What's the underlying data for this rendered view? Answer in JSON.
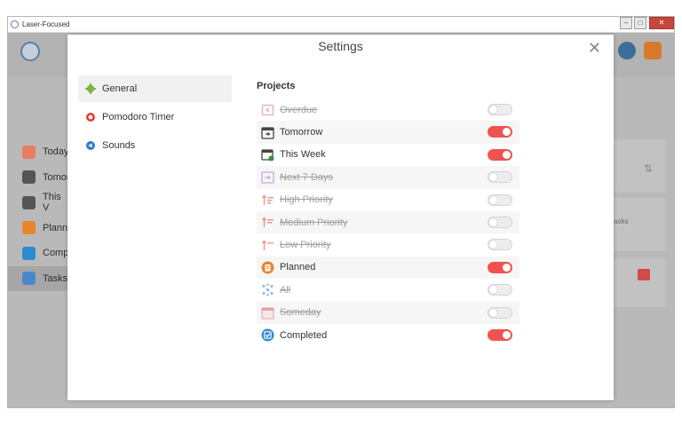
{
  "window": {
    "title": "Laser-Focused"
  },
  "background": {
    "sidebar_items": [
      {
        "label": "Today",
        "color": "#e67e62",
        "selected": false
      },
      {
        "label": "Tomor",
        "color": "#555555",
        "selected": false
      },
      {
        "label": "This V",
        "color": "#555555",
        "selected": false
      },
      {
        "label": "Plann",
        "color": "#e8862e",
        "selected": false
      },
      {
        "label": "Comp",
        "color": "#2f8bd0",
        "selected": false
      },
      {
        "label": "Tasks",
        "color": "#4c88c9",
        "selected": true
      }
    ],
    "right_text": "asks",
    "sort_icon_glyph": "⇅"
  },
  "settings": {
    "title": "Settings",
    "close_glyph": "✕",
    "nav": [
      {
        "label": "General",
        "icon": "gear-icon",
        "color": "#7cb342",
        "active": true
      },
      {
        "label": "Pomodoro Timer",
        "icon": "timer-icon",
        "color": "#e53935",
        "active": false
      },
      {
        "label": "Sounds",
        "icon": "speaker-icon",
        "color": "#2f7fcf",
        "active": false
      }
    ],
    "projects_heading": "Projects",
    "projects": [
      {
        "label": "Overdue",
        "icon": "overdue-icon",
        "color": "#e0575a",
        "enabled": false
      },
      {
        "label": "Tomorrow",
        "icon": "tomorrow-icon",
        "color": "#444444",
        "enabled": true
      },
      {
        "label": "This Week",
        "icon": "this-week-icon",
        "color": "#444444",
        "enabled": true
      },
      {
        "label": "Next 7 Days",
        "icon": "next-7-days-icon",
        "color": "#8e5bd3",
        "enabled": false
      },
      {
        "label": "High Priority",
        "icon": "high-priority-icon",
        "color": "#e53935",
        "enabled": false
      },
      {
        "label": "Medium Priority",
        "icon": "medium-priority-icon",
        "color": "#e53935",
        "enabled": false
      },
      {
        "label": "Low Priority",
        "icon": "low-priority-icon",
        "color": "#e53935",
        "enabled": false
      },
      {
        "label": "Planned",
        "icon": "planned-icon",
        "color": "#e8862e",
        "enabled": true
      },
      {
        "label": "All",
        "icon": "all-icon",
        "color": "#2f7fcf",
        "enabled": false
      },
      {
        "label": "Someday",
        "icon": "someday-icon",
        "color": "#d84a4a",
        "enabled": false
      },
      {
        "label": "Completed",
        "icon": "completed-icon",
        "color": "#2f8bd0",
        "enabled": true
      }
    ]
  },
  "colors": {
    "toggle_on": "#ef5350",
    "accent": "#7cb342"
  }
}
